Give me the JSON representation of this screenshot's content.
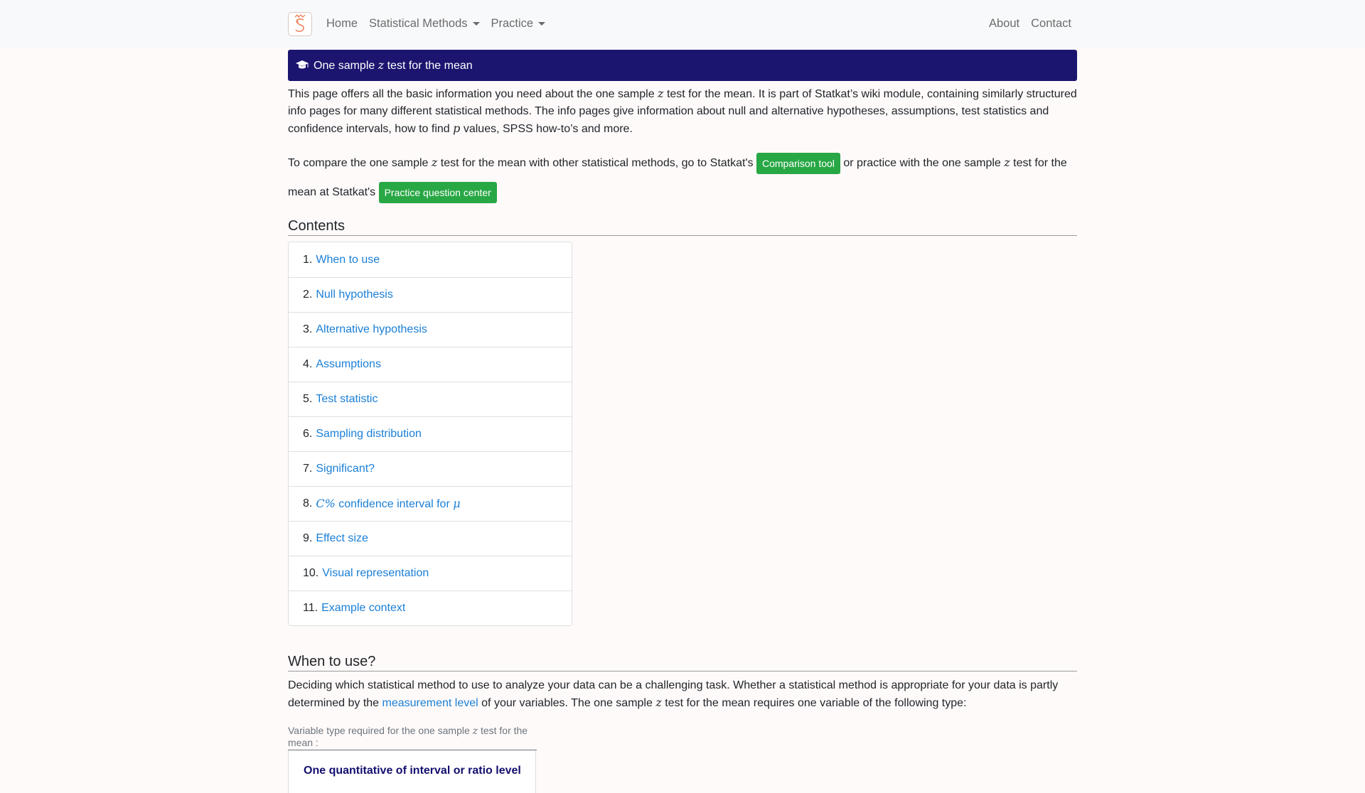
{
  "nav": {
    "brand_icon": "statkat-logo-icon",
    "items": [
      {
        "label": "Home",
        "dropdown": false
      },
      {
        "label": "Statistical Methods",
        "dropdown": true
      },
      {
        "label": "Practice",
        "dropdown": true
      }
    ],
    "right_items": [
      {
        "label": "About"
      },
      {
        "label": "Contact"
      }
    ]
  },
  "header": {
    "icon": "graduation-cap-icon",
    "title_prefix": "One sample",
    "title_var": "z",
    "title_suffix": "test for the mean"
  },
  "intro": {
    "p1_a": "This page offers all the basic information you need about the one sample",
    "p1_var": "z",
    "p1_b": "test for the mean. It is part of Statkat’s wiki module, containing similarly structured info pages for many different statistical methods. The info pages give information about null and alternative hypotheses, assumptions, test statistics and confidence intervals, how to find",
    "p1_pvar": "p",
    "p1_c": "values, SPSS how-to’s and more.",
    "p2_a": "To compare the one sample",
    "p2_var": "z",
    "p2_b": "test for the mean with other statistical methods, go to Statkat's",
    "comparison_button": "Comparison tool",
    "p2_c": "or practice with the one sample",
    "p2_var2": "z",
    "p2_d": "test for the mean at Statkat's",
    "practice_button": "Practice question center"
  },
  "contents": {
    "heading": "Contents",
    "items": [
      {
        "num": "1.",
        "label": "When to use"
      },
      {
        "num": "2.",
        "label": "Null hypothesis"
      },
      {
        "num": "3.",
        "label": "Alternative hypothesis"
      },
      {
        "num": "4.",
        "label": "Assumptions"
      },
      {
        "num": "5.",
        "label": "Test statistic"
      },
      {
        "num": "6.",
        "label": "Sampling distribution"
      },
      {
        "num": "7.",
        "label": "Significant?"
      },
      {
        "num": "8.",
        "label_math_a": "C%",
        "label": "confidence interval for",
        "label_math_b": "μ"
      },
      {
        "num": "9.",
        "label": "Effect size"
      },
      {
        "num": "10.",
        "label": "Visual representation"
      },
      {
        "num": "11.",
        "label": "Example context"
      }
    ]
  },
  "when_to_use": {
    "heading": "When to use?",
    "p_a": "Deciding which statistical method to use to analyze your data can be a challenging task. Whether a statistical method is appropriate for your data is partly determined by the",
    "p_link": "measurement level",
    "p_b": "of your variables. The one sample",
    "p_var": "z",
    "p_c": "test for the mean requires one variable of the following type:",
    "caption_a": "Variable type required for the one sample",
    "caption_var": "z",
    "caption_b": "test for the mean :",
    "variable_type": "One quantitative of interval or ratio level"
  },
  "colors": {
    "title_bar": "#1c1570",
    "button_green": "#28a745",
    "link": "#1a7fd6",
    "navbar_bg": "#f8f9fa"
  }
}
